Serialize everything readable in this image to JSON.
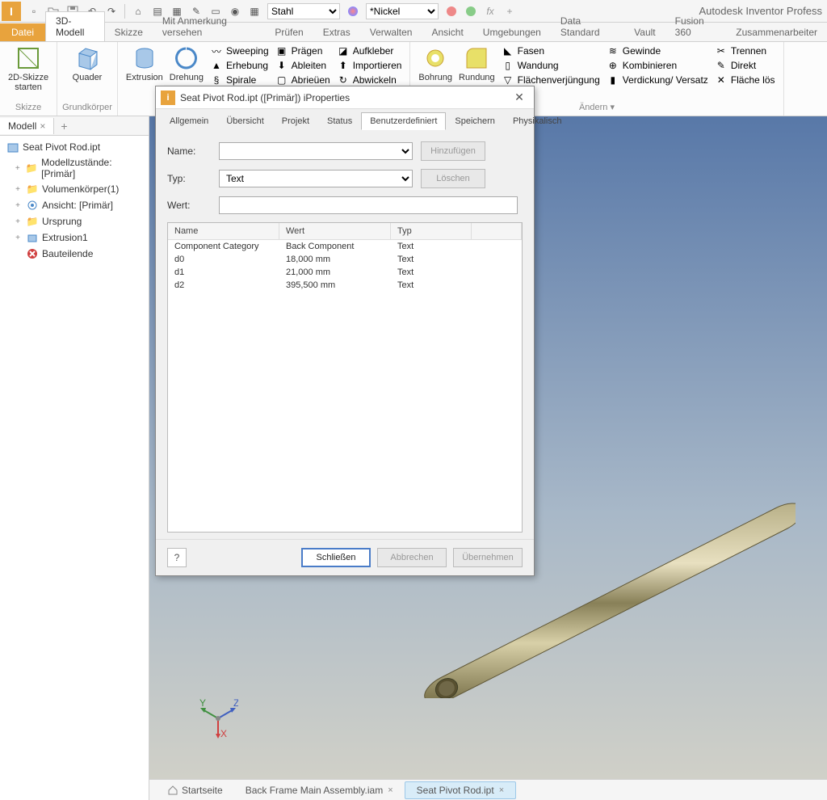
{
  "app_title": "Autodesk Inventor Profess",
  "qat": {
    "material1": "Stahl",
    "material2": "*Nickel",
    "fx_label": "fx"
  },
  "ribbon_tabs": {
    "file": "Datei",
    "items": [
      "3D-Modell",
      "Skizze",
      "Mit Anmerkung versehen",
      "Prüfen",
      "Extras",
      "Verwalten",
      "Ansicht",
      "Umgebungen",
      "Data Standard",
      "Vault",
      "Fusion 360",
      "Zusammenarbeiter"
    ],
    "active": "3D-Modell"
  },
  "ribbon": {
    "g1": {
      "label": "2D-Skizze\nstarten",
      "title": "Skizze"
    },
    "g2": {
      "label": "Quader",
      "title": "Grundkörper"
    },
    "g3": {
      "l1": "Extrusion",
      "l2": "Drehung",
      "small": [
        "Sweeping",
        "Erhebung",
        "Spirale",
        "Prägen",
        "Ableiten",
        "Abrieüen",
        "Aufkleber",
        "Importieren",
        "Abwickeln"
      ]
    },
    "g4": {
      "l1": "Bohrung",
      "l2": "Rundung",
      "small": [
        "Fasen",
        "Wandung",
        "Flächenverjüngung",
        "Gewinde",
        "Kombinieren",
        "Verdickung/ Versatz",
        "Trennen",
        "Direkt",
        "Fläche lös"
      ]
    },
    "g4_title": "Ändern ▾"
  },
  "browser": {
    "tab": "Modell",
    "root": "Seat Pivot Rod.ipt",
    "items": [
      {
        "icon": "folder",
        "label": "Modellzustände: [Primär]"
      },
      {
        "icon": "folder",
        "label": "Volumenkörper(1)"
      },
      {
        "icon": "view",
        "label": "Ansicht: [Primär]"
      },
      {
        "icon": "folder",
        "label": "Ursprung"
      },
      {
        "icon": "feature",
        "label": "Extrusion1"
      },
      {
        "icon": "end",
        "label": "Bauteilende"
      }
    ]
  },
  "dialog": {
    "title": "Seat Pivot Rod.ipt ([Primär]) iProperties",
    "tabs": [
      "Allgemein",
      "Übersicht",
      "Projekt",
      "Status",
      "Benutzerdefiniert",
      "Speichern",
      "Physikalisch"
    ],
    "active_tab": "Benutzerdefiniert",
    "labels": {
      "name": "Name:",
      "typ": "Typ:",
      "wert": "Wert:"
    },
    "typ_value": "Text",
    "btn_add": "Hinzufügen",
    "btn_del": "Löschen",
    "columns": {
      "name": "Name",
      "wert": "Wert",
      "typ": "Typ"
    },
    "rows": [
      {
        "name": "Component Category",
        "wert": "Back Component",
        "typ": "Text"
      },
      {
        "name": "d0",
        "wert": "18,000 mm",
        "typ": "Text"
      },
      {
        "name": "d1",
        "wert": "21,000 mm",
        "typ": "Text"
      },
      {
        "name": "d2",
        "wert": "395,500 mm",
        "typ": "Text"
      }
    ],
    "btn_close": "Schließen",
    "btn_cancel": "Abbrechen",
    "btn_apply": "Übernehmen"
  },
  "bottom_tabs": {
    "home": "Startseite",
    "items": [
      {
        "label": "Back Frame Main Assembly.iam",
        "active": false
      },
      {
        "label": "Seat Pivot Rod.ipt",
        "active": true
      }
    ]
  }
}
